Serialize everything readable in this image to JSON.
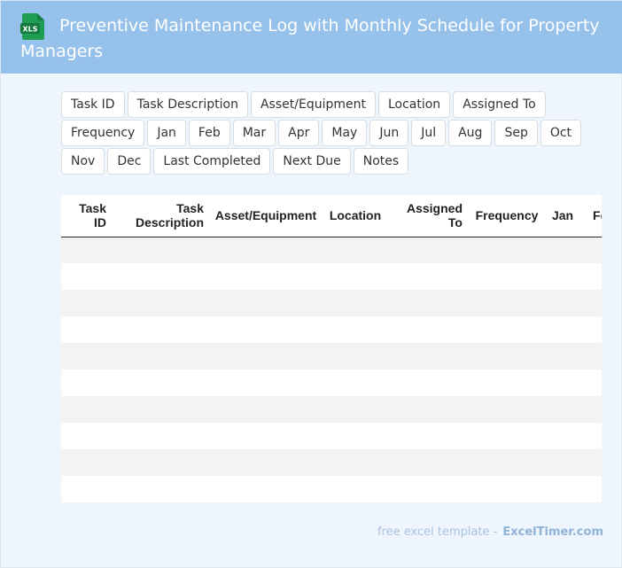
{
  "header": {
    "title": "Preventive Maintenance Log with Monthly Schedule for Property Managers",
    "icon": "xls-file-icon",
    "icon_label": "XLS",
    "background": "#96c1ea"
  },
  "chips": [
    "Task ID",
    "Task Description",
    "Asset/Equipment",
    "Location",
    "Assigned To",
    "Frequency",
    "Jan",
    "Feb",
    "Mar",
    "Apr",
    "May",
    "Jun",
    "Jul",
    "Aug",
    "Sep",
    "Oct",
    "Nov",
    "Dec",
    "Last Completed",
    "Next Due",
    "Notes"
  ],
  "table": {
    "columns": [
      "Task ID",
      "Task Description",
      "Asset/Equipment",
      "Location",
      "Assigned To",
      "Frequency",
      "Jan",
      "Feb"
    ],
    "row_count": 10
  },
  "footer": {
    "prefix": "free excel template -",
    "brand": "ExcelTimer.com"
  }
}
